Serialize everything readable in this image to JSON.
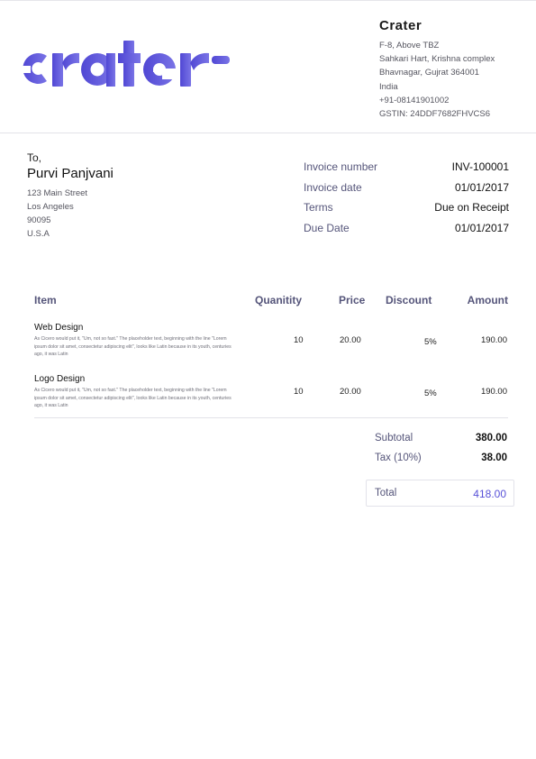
{
  "logo": {
    "text": "crater",
    "color": "#5851d8"
  },
  "company": {
    "name": "Crater",
    "lines": [
      "F-8, Above TBZ",
      "Sahkari Hart, Krishna complex",
      "Bhavnagar, Gujrat 364001",
      "India",
      "+91-08141901002",
      "GSTIN: 24DDF7682FHVCS6"
    ]
  },
  "billing": {
    "to_label": "To,",
    "name": "Purvi Panjvani",
    "address": [
      "123 Main Street",
      "Los Angeles",
      "90095",
      "U.S.A"
    ]
  },
  "meta": [
    {
      "label": "Invoice number",
      "value": "INV-100001"
    },
    {
      "label": "Invoice date",
      "value": "01/01/2017"
    },
    {
      "label": "Terms",
      "value": "Due on Receipt"
    },
    {
      "label": "Due Date",
      "value": "01/01/2017"
    }
  ],
  "table": {
    "headers": {
      "item": "Item",
      "quantity": "Quanitity",
      "price": "Price",
      "discount": "Discount",
      "amount": "Amount"
    },
    "rows": [
      {
        "name": "Web Design",
        "description": "As Cicero would put it, \"Um, not so fast.\" The placeholder text, beginning with the line \"Lorem ipsum dolor sit amet, consectetur adipiscing elit\", looks like Latin because in its youth, centuries ago, it was Latin",
        "quantity": "10",
        "price": "20.00",
        "discount": "5%",
        "amount": "190.00"
      },
      {
        "name": "Logo Design",
        "description": "As Cicero would put it, \"Um, not so fast.\" The placeholder text, beginning with the line \"Lorem ipsum dolor sit amet, consectetur adipiscing elit\", looks like Latin because in its youth, centuries ago, it was Latin",
        "quantity": "10",
        "price": "20.00",
        "discount": "5%",
        "amount": "190.00"
      }
    ]
  },
  "totals": {
    "subtotal_label": "Subtotal",
    "subtotal": "380.00",
    "tax_label": "Tax (10%)",
    "tax": "38.00",
    "total_label": "Total",
    "total": "418.00"
  }
}
